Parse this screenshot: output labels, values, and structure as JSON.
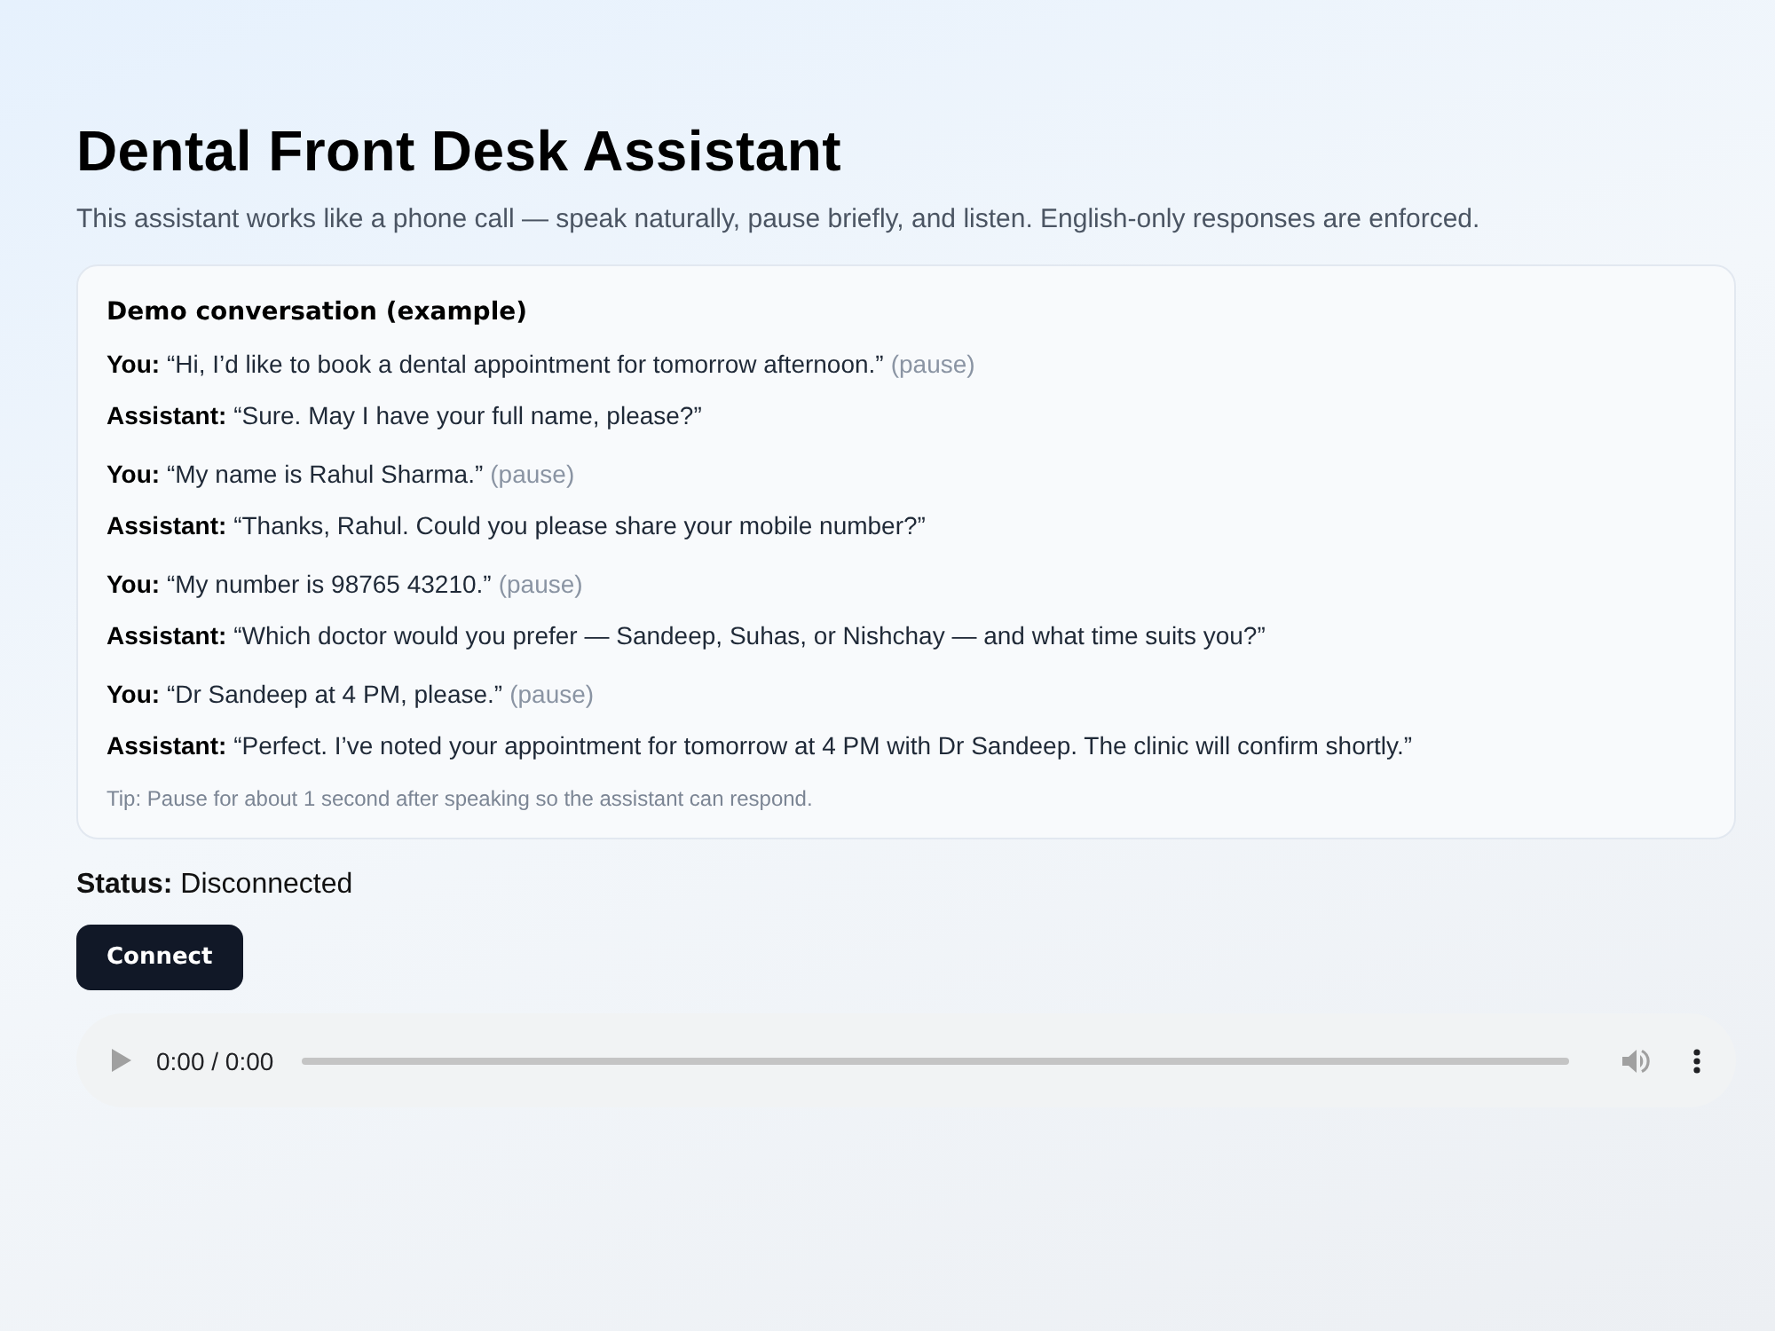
{
  "page": {
    "title": "Dental Front Desk Assistant",
    "subtitle": "This assistant works like a phone call — speak naturally, pause briefly, and listen. English-only responses are enforced."
  },
  "demo": {
    "heading": "Demo conversation (example)",
    "exchanges": [
      {
        "you": {
          "line": "**You:** “Hi, I’d like to book a dental appointment for tomorrow afternoon.”",
          "note": "(pause)"
        },
        "assistant": {
          "line": "**Assistant:** “Sure. May I have your full name, please?”"
        }
      },
      {
        "you": {
          "line": "**You:** “My name is Rahul Sharma.”",
          "note": "(pause)"
        },
        "assistant": {
          "line": "**Assistant:** “Thanks, Rahul. Could you please share your mobile number?”"
        }
      },
      {
        "you": {
          "line": "**You:** “My number is 98765 43210.”",
          "note": "(pause)"
        },
        "assistant": {
          "line": "**Assistant:** “Which doctor would you prefer — Sandeep, Suhas, or Nishchay — and what time suits you?”"
        }
      },
      {
        "you": {
          "line": "**You:** “Dr Sandeep at 4 PM, please.”",
          "note": "(pause)"
        },
        "assistant": {
          "line": "**Assistant:** “Perfect. I’ve noted your appointment for tomorrow at 4 PM with Dr Sandeep. The clinic will confirm shortly.”"
        }
      }
    ],
    "tip": "Tip: Pause for about 1 second after speaking so the assistant can respond."
  },
  "status": {
    "text": "**Status:** Disconnected"
  },
  "connect_button": {
    "label": "Connect"
  },
  "audio_player": {
    "time": "0:00 / 0:00"
  }
}
